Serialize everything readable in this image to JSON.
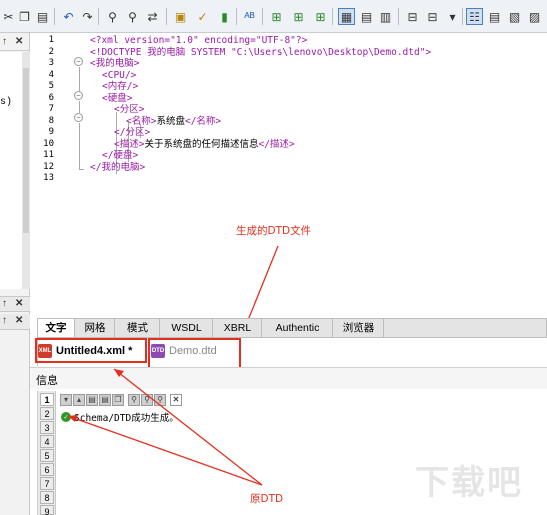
{
  "toolbar": {
    "icons": [
      "cut-icon",
      "copy-icon",
      "paste-icon",
      "undo-icon",
      "redo-icon",
      "find-icon",
      "find-next-icon",
      "replace-icon",
      "check-wellformed-icon",
      "validate-icon",
      "validate-xml-icon",
      "spellcheck-icon",
      "xslt-icon",
      "xquery-icon",
      "schema-icon",
      "text-view-icon",
      "grid-view-icon",
      "schema-view-icon",
      "db-icon",
      "layout-icon",
      "browser-icon",
      "options-icon",
      "tree-icon",
      "document-icon",
      "print-icon"
    ]
  },
  "editor": {
    "line_numbers": [
      "1",
      "2",
      "3",
      "4",
      "5",
      "6",
      "7",
      "8",
      "9",
      "10",
      "11",
      "12",
      "13"
    ],
    "lines": [
      {
        "indent": 0,
        "tag": "<?xml version=\"1.0\" encoding=\"UTF-8\"?>",
        "text": ""
      },
      {
        "indent": 0,
        "tag": "<!DOCTYPE 我的电脑 SYSTEM \"C:\\Users\\lenovo\\Desktop\\Demo.dtd\">",
        "text": ""
      },
      {
        "indent": 0,
        "tag": "<我的电脑>",
        "text": ""
      },
      {
        "indent": 1,
        "tag": "<CPU/>",
        "text": ""
      },
      {
        "indent": 1,
        "tag": "<内存/>",
        "text": ""
      },
      {
        "indent": 1,
        "tag": "<硬盘>",
        "text": ""
      },
      {
        "indent": 2,
        "tag": "<分区>",
        "text": ""
      },
      {
        "indent": 3,
        "tag": "<名称>",
        "text": "系统盘",
        "close": "</名称>"
      },
      {
        "indent": 2,
        "tag": "</分区>",
        "text": ""
      },
      {
        "indent": 2,
        "tag": "<描述>",
        "text": "关于系统盘的任何描述信息",
        "close": "</描述>"
      },
      {
        "indent": 1,
        "tag": "</硬盘>",
        "text": ""
      },
      {
        "indent": 0,
        "tag": "</我的电脑>",
        "text": ""
      },
      {
        "indent": 0,
        "tag": "",
        "text": ""
      }
    ]
  },
  "annotations": {
    "generated_dtd": "生成的DTD文件",
    "original_dtd": "原DTD"
  },
  "view_tabs": [
    "文字",
    "网格",
    "模式",
    "WSDL",
    "XBRL",
    "Authentic",
    "浏览器"
  ],
  "doc_tabs": {
    "first_label": "Untitled4.xml *",
    "first_icon_text": "XML",
    "second_label": "Demo.dtd",
    "second_icon_text": "DTD"
  },
  "info": {
    "header": "信息",
    "message": "Schema/DTD成功生成。",
    "tab_numbers": [
      "1",
      "2",
      "3",
      "4",
      "5",
      "6",
      "7",
      "8",
      "9"
    ]
  },
  "left_pane": {
    "snippet": "s)"
  },
  "watermark": "下载吧",
  "colors": {
    "tag": "#9a1aa8",
    "annotation": "#e62e1e",
    "active_toolbar": "#cfe0f6"
  }
}
